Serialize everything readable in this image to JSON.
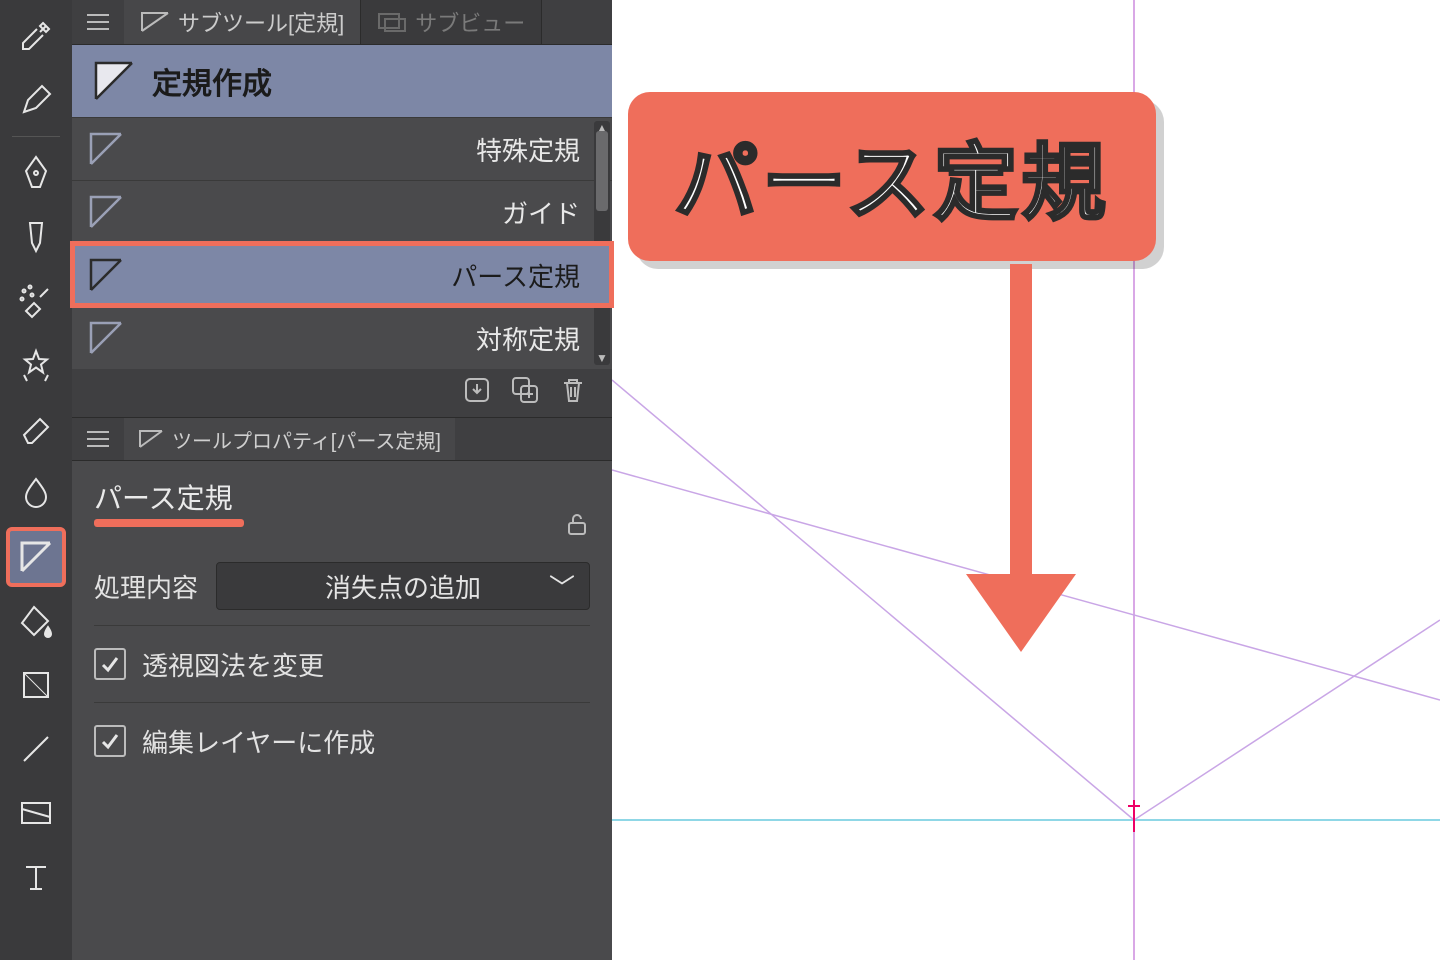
{
  "callout": "パース定規",
  "subtool_panel": {
    "tab_active": "サブツール[定規]",
    "tab_inactive": "サブビュー",
    "group_tab": "定規作成",
    "items": {
      "special": "特殊定規",
      "guide": "ガイド",
      "perspective": "パース定規",
      "symmetry": "対称定規"
    }
  },
  "tool_property": {
    "tab": "ツールプロパティ[パース定規]",
    "title": "パース定規",
    "process_label": "処理内容",
    "process_value": "消失点の追加",
    "check1": "透視図法を変更",
    "check2": "編集レイヤーに作成"
  },
  "colors": {
    "accent": "#ef6e5b",
    "sel": "#7d87a6"
  }
}
